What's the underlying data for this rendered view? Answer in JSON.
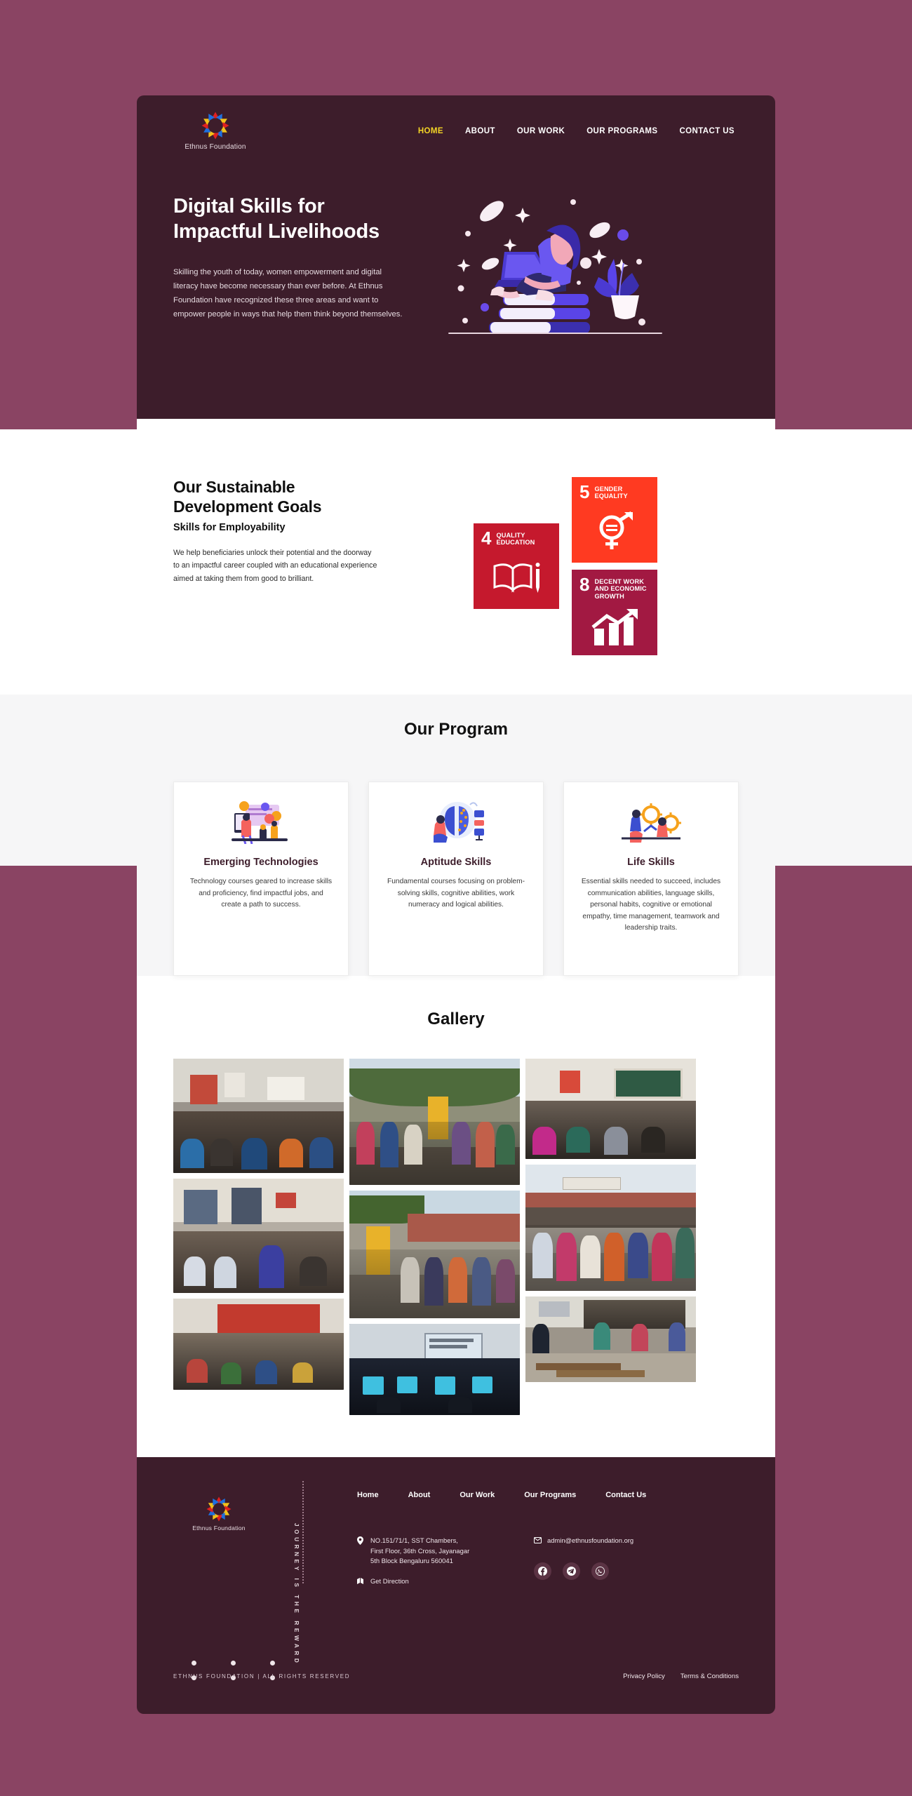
{
  "brand": {
    "name": "Ethnus Foundation",
    "logo_icon": "ethnus-ring-logo"
  },
  "nav": {
    "items": [
      {
        "label": "HOME",
        "active": true
      },
      {
        "label": "ABOUT",
        "active": false
      },
      {
        "label": "OUR WORK",
        "active": false
      },
      {
        "label": "OUR PROGRAMS",
        "active": false
      },
      {
        "label": "CONTACT US",
        "active": false
      }
    ]
  },
  "hero": {
    "title_line1": "Digital Skills for",
    "title_line2": "Impactful Livelihoods",
    "paragraph": "Skilling the youth of today, women empowerment and digital literacy have become necessary than ever before. At Ethnus Foundation have recognized these three areas and want to empower people in ways that help them think beyond themselves.",
    "illustration": "woman-reading-on-books-with-laptop",
    "bg_color": "#3d1d2b"
  },
  "sdg": {
    "heading_line1": "Our Sustainable",
    "heading_line2": "Development Goals",
    "subheading": "Skills for Employability",
    "paragraph": "We help beneficiaries unlock their potential and the doorway to an impactful career coupled with an educational experience aimed at taking them from good to brilliant.",
    "goals": [
      {
        "number": "4",
        "label": "QUALITY EDUCATION",
        "color": "#c5192d",
        "icon": "open-book-and-pencil-icon"
      },
      {
        "number": "5",
        "label": "GENDER EQUALITY",
        "color": "#ff3a21",
        "icon": "gender-equality-symbol-icon"
      },
      {
        "number": "8",
        "label": "DECENT WORK AND ECONOMIC GROWTH",
        "color": "#a21942",
        "icon": "rising-bar-chart-arrow-icon"
      }
    ]
  },
  "program": {
    "title": "Our Program",
    "cards": [
      {
        "name": "Emerging Technologies",
        "description": "Technology courses geared to increase skills and proficiency, find impactful jobs, and create a path to success.",
        "illustration": "presentation-screen-with-people-icon"
      },
      {
        "name": "Aptitude Skills",
        "description": "Fundamental courses focusing on problem-solving skills, cognitive abilities, work numeracy and logical abilities.",
        "illustration": "brain-and-person-thinking-icon"
      },
      {
        "name": "Life Skills",
        "description": "Essential skills needed to succeed, includes communication abilities, language skills, personal habits, cognitive or emotional empathy, time management, teamwork and leadership traits.",
        "illustration": "people-with-gears-and-lightbulb-icon"
      }
    ]
  },
  "gallery": {
    "title": "Gallery",
    "photos": [
      {
        "alt": "Classroom session with seated students and presenter",
        "scene": "classroom-seated"
      },
      {
        "alt": "Large group of students standing outdoors near banner",
        "scene": "outdoor-group"
      },
      {
        "alt": "Classroom with green chalkboard and speaker",
        "scene": "chalkboard-class"
      },
      {
        "alt": "Students seated in classroom listening to trainer",
        "scene": "classroom-trainer"
      },
      {
        "alt": "Students gathered outdoors in front of building with standee",
        "scene": "outdoor-standee"
      },
      {
        "alt": "Students standing in courtyard of red school building",
        "scene": "courtyard-group"
      },
      {
        "alt": "Auditorium filled with students and red curtains",
        "scene": "auditorium-red"
      },
      {
        "alt": "Computer lab session with projector screen",
        "scene": "computer-lab"
      },
      {
        "alt": "Large hall full of students attending session",
        "scene": "hall-session"
      }
    ]
  },
  "footer": {
    "vertical_tagline": "JOURNEY IS THE REWARD",
    "nav": [
      {
        "label": "Home"
      },
      {
        "label": "About"
      },
      {
        "label": "Our Work"
      },
      {
        "label": "Our Programs"
      },
      {
        "label": "Contact Us"
      }
    ],
    "address": {
      "icon": "map-pin-icon",
      "line1": "NO.151/71/1, SST Chambers,",
      "line2": "First Floor, 36th Cross, Jayanagar",
      "line3": "5th Block Bengaluru 560041"
    },
    "direction": {
      "icon": "directions-icon",
      "label": "Get Direction"
    },
    "email": {
      "icon": "mail-icon",
      "value": "admin@ethnusfoundation.org"
    },
    "social": [
      {
        "name": "facebook-icon"
      },
      {
        "name": "telegram-icon"
      },
      {
        "name": "whatsapp-icon"
      }
    ],
    "copyright": "ETHNUS FOUNDATION  |  ALL RIGHTS RESERVED",
    "legal_links": [
      {
        "label": "Privacy Policy"
      },
      {
        "label": "Terms & Conditions"
      }
    ]
  }
}
